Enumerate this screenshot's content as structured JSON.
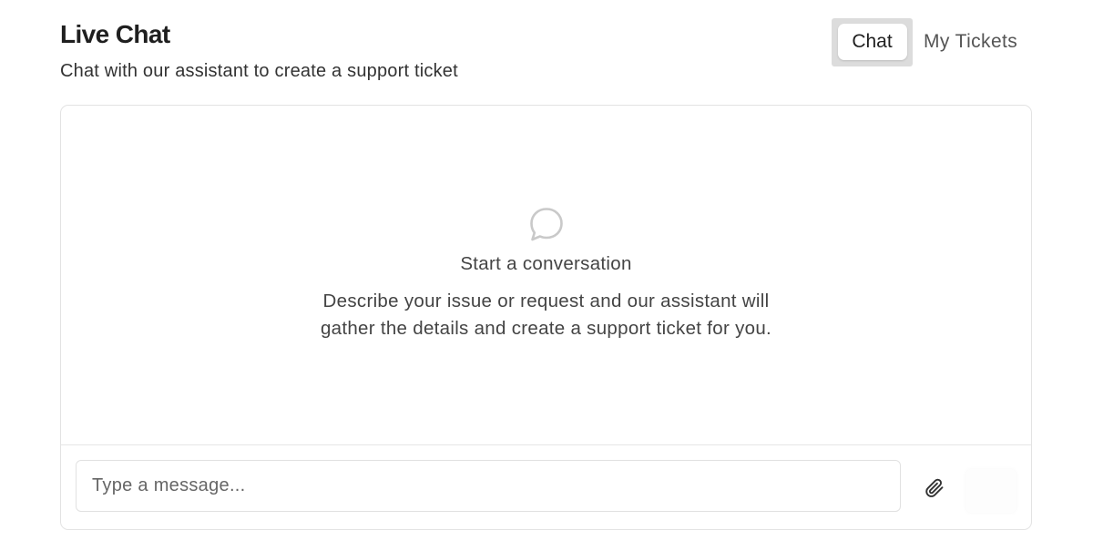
{
  "header": {
    "title": "Live Chat",
    "subtitle": "Chat with our assistant to create a support ticket"
  },
  "tabs": [
    {
      "label": "Chat",
      "active": true
    },
    {
      "label": "My Tickets",
      "active": false
    }
  ],
  "empty_state": {
    "icon": "chat-bubble-icon",
    "title": "Start a conversation",
    "description": "Describe your issue or request and our assistant will gather the details and create a support ticket for you."
  },
  "composer": {
    "placeholder": "Type a message...",
    "value": "",
    "attach_icon": "paperclip-icon",
    "send_icon": "send-icon"
  },
  "colors": {
    "border": "#e3e3e3",
    "text_primary": "#1f1f1f",
    "text_secondary": "#444444",
    "icon_muted": "#c9c9c9"
  }
}
